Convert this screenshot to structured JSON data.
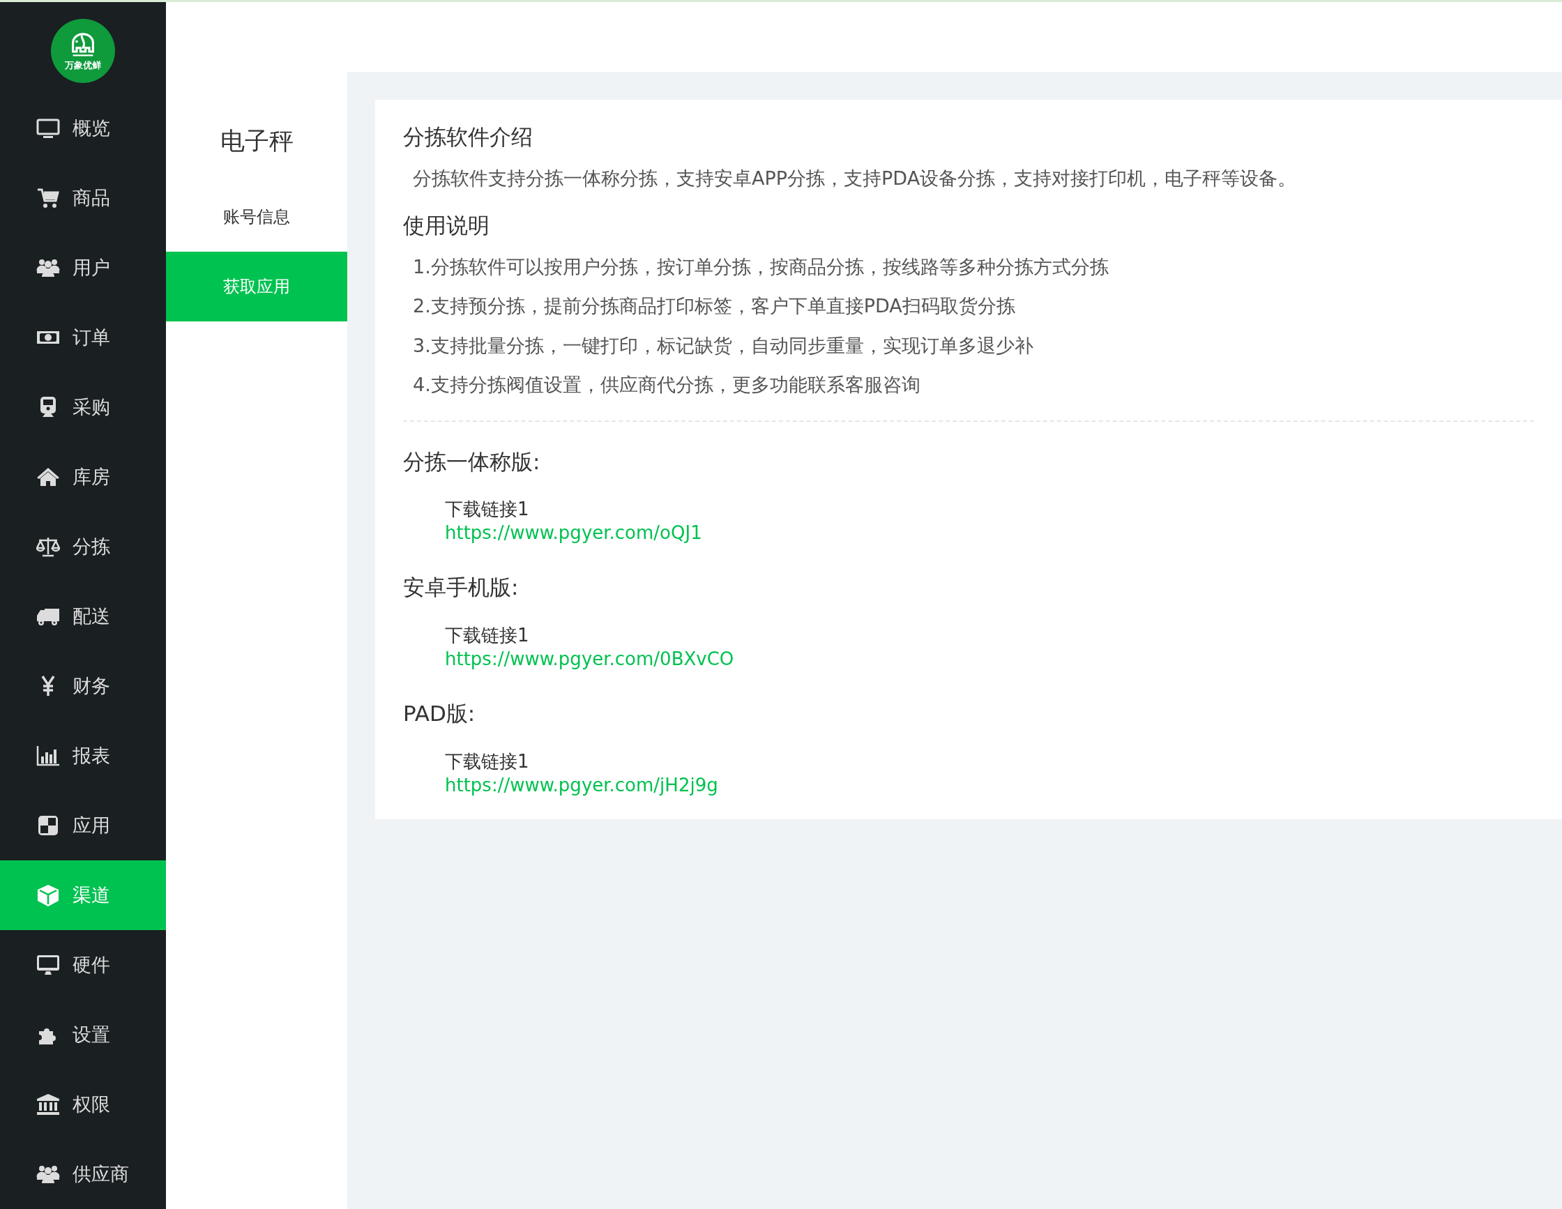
{
  "logo": {
    "text": "万象优鲜"
  },
  "sidebar": {
    "items": [
      {
        "label": "概览",
        "selected": false
      },
      {
        "label": "商品",
        "selected": false
      },
      {
        "label": "用户",
        "selected": false
      },
      {
        "label": "订单",
        "selected": false
      },
      {
        "label": "采购",
        "selected": false
      },
      {
        "label": "库房",
        "selected": false
      },
      {
        "label": "分拣",
        "selected": false
      },
      {
        "label": "配送",
        "selected": false
      },
      {
        "label": "财务",
        "selected": false
      },
      {
        "label": "报表",
        "selected": false
      },
      {
        "label": "应用",
        "selected": false
      },
      {
        "label": "渠道",
        "selected": true
      },
      {
        "label": "硬件",
        "selected": false
      },
      {
        "label": "设置",
        "selected": false
      },
      {
        "label": "权限",
        "selected": false
      },
      {
        "label": "供应商",
        "selected": false
      }
    ]
  },
  "subnav": {
    "title": "电子秤",
    "items": [
      {
        "label": "账号信息",
        "selected": false
      },
      {
        "label": "获取应用",
        "selected": true
      }
    ]
  },
  "content": {
    "intro_title": "分拣软件介绍",
    "intro_text": "分拣软件支持分拣一体称分拣，支持安卓APP分拣，支持PDA设备分拣，支持对接打印机，电子秤等设备。",
    "usage_title": "使用说明",
    "usage_items": [
      "1.分拣软件可以按用户分拣，按订单分拣，按商品分拣，按线路等多种分拣方式分拣",
      "2.支持预分拣，提前分拣商品打印标签，客户下单直接PDA扫码取货分拣",
      "3.支持批量分拣，一键打印，标记缺货，自动同步重量，实现订单多退少补",
      "4.支持分拣阀值设置，供应商代分拣，更多功能联系客服咨询"
    ],
    "downloads": [
      {
        "title": "分拣一体称版:",
        "link_label": "下载链接1",
        "url": "https://www.pgyer.com/oQJ1"
      },
      {
        "title": "安卓手机版:",
        "link_label": "下载链接1",
        "url": "https://www.pgyer.com/0BXvCO"
      },
      {
        "title": "PAD版:",
        "link_label": "下载链接1",
        "url": "https://www.pgyer.com/jH2j9g"
      }
    ]
  }
}
